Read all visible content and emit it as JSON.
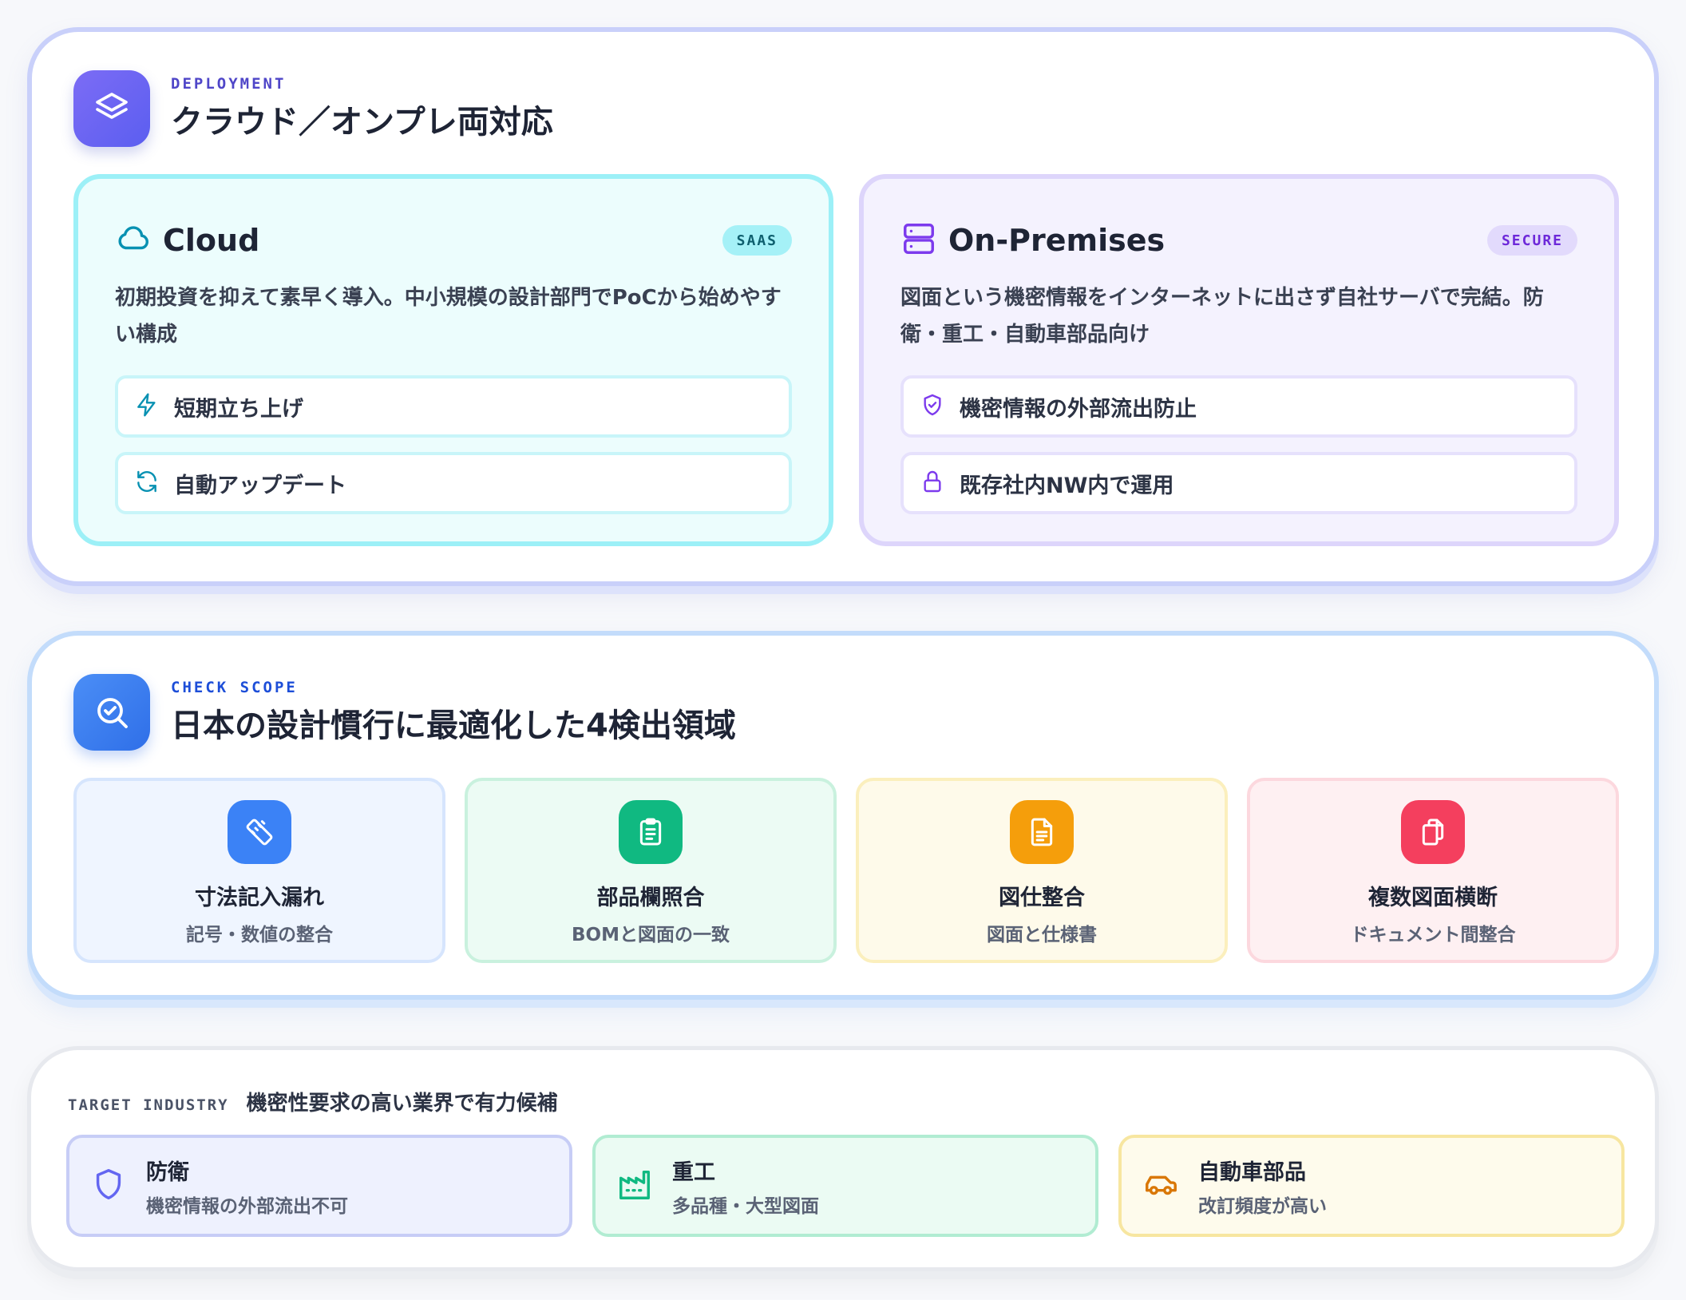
{
  "deployment": {
    "eyebrow": "DEPLOYMENT",
    "title": "クラウド／オンプレ両対応",
    "icon": "layers-icon",
    "cloud": {
      "title": "Cloud",
      "badge": "SAAS",
      "icon": "cloud-icon",
      "description": "初期投資を抑えて素早く導入。中小規模の設計部門でPoCから始めやすい構成",
      "features": [
        {
          "label": "短期立ち上げ",
          "icon": "lightning-icon"
        },
        {
          "label": "自動アップデート",
          "icon": "refresh-icon"
        }
      ]
    },
    "onprem": {
      "title": "On-Premises",
      "badge": "SECURE",
      "icon": "server-icon",
      "description": "図面という機密情報をインターネットに出さず自社サーバで完結。防衛・重工・自動車部品向け",
      "features": [
        {
          "label": "機密情報の外部流出防止",
          "icon": "shield-check-icon"
        },
        {
          "label": "既存社内NW内で運用",
          "icon": "lock-icon"
        }
      ]
    }
  },
  "check_scope": {
    "eyebrow": "CHECK SCOPE",
    "title": "日本の設計慣行に最適化した4検出領域",
    "icon": "search-check-icon",
    "areas": [
      {
        "title": "寸法記入漏れ",
        "subtitle": "記号・数値の整合",
        "icon": "ruler-icon",
        "color": "#3b82f6"
      },
      {
        "title": "部品欄照合",
        "subtitle": "BOMと図面の一致",
        "icon": "clipboard-icon",
        "color": "#10b981"
      },
      {
        "title": "図仕整合",
        "subtitle": "図面と仕様書",
        "icon": "document-icon",
        "color": "#f59e0b"
      },
      {
        "title": "複数図面横断",
        "subtitle": "ドキュメント間整合",
        "icon": "copy-icon",
        "color": "#f43f5e"
      }
    ]
  },
  "target_industry": {
    "eyebrow": "TARGET INDUSTRY",
    "title": "機密性要求の高い業界で有力候補",
    "industries": [
      {
        "title": "防衛",
        "subtitle": "機密情報の外部流出不可",
        "icon": "shield-icon",
        "color": "#6366f1"
      },
      {
        "title": "重工",
        "subtitle": "多品種・大型図面",
        "icon": "factory-icon",
        "color": "#10b981"
      },
      {
        "title": "自動車部品",
        "subtitle": "改訂頻度が高い",
        "icon": "car-icon",
        "color": "#d97706"
      }
    ]
  }
}
